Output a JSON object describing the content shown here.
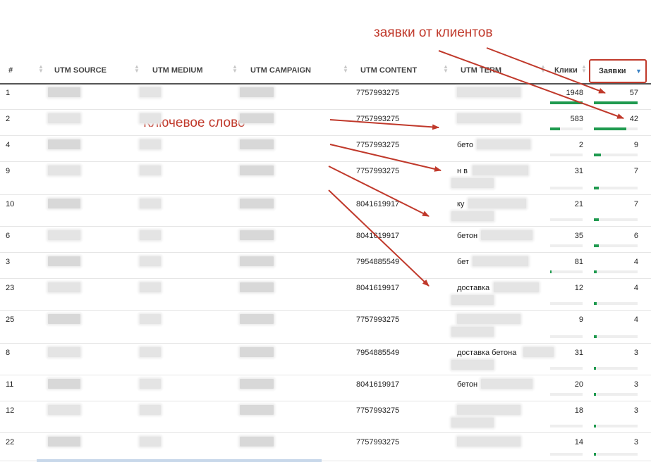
{
  "annotations": {
    "top": "заявки от клиентов",
    "keyword": "Ключевое слово"
  },
  "header": {
    "num": "#",
    "utm_source": "UTM SOURCE",
    "utm_medium": "UTM MEDIUM",
    "utm_campaign": "UTM CAMPAIGN",
    "utm_content": "UTM CONTENT",
    "utm_term": "UTM TERM",
    "clicks": "Клики",
    "leads": "Заявки"
  },
  "colors": {
    "accent_red": "#c0392b",
    "bar_green": "#1f9a4f",
    "sort_blue": "#3b82c4"
  },
  "rows": [
    {
      "num": "1",
      "content": "7757993275",
      "term": "",
      "clicks": "1948",
      "leads": "57",
      "clicks_frac": 1.0,
      "leads_frac": 1.0
    },
    {
      "num": "2",
      "content": "7757993275",
      "term": "",
      "clicks": "583",
      "leads": "42",
      "clicks_frac": 0.3,
      "leads_frac": 0.74
    },
    {
      "num": "4",
      "content": "7757993275",
      "term": "бето",
      "clicks": "2",
      "leads": "9",
      "clicks_frac": 0.0,
      "leads_frac": 0.16
    },
    {
      "num": "9",
      "content": "7757993275",
      "term": "н в",
      "clicks": "31",
      "leads": "7",
      "clicks_frac": 0.0,
      "leads_frac": 0.12
    },
    {
      "num": "10",
      "content": "8041619917",
      "term": "ку",
      "term2": "кра",
      "clicks": "21",
      "leads": "7",
      "clicks_frac": 0.0,
      "leads_frac": 0.12
    },
    {
      "num": "6",
      "content": "8041619917",
      "term": "бетон",
      "clicks": "35",
      "leads": "6",
      "clicks_frac": 0.0,
      "leads_frac": 0.11
    },
    {
      "num": "3",
      "content": "7954885549",
      "term": "бет",
      "clicks": "81",
      "leads": "4",
      "clicks_frac": 0.04,
      "leads_frac": 0.07
    },
    {
      "num": "23",
      "content": "8041619917",
      "term": "доставка",
      "clicks": "12",
      "leads": "4",
      "clicks_frac": 0.0,
      "leads_frac": 0.07
    },
    {
      "num": "25",
      "content": "7757993275",
      "term": "",
      "clicks": "9",
      "leads": "4",
      "clicks_frac": 0.0,
      "leads_frac": 0.07
    },
    {
      "num": "8",
      "content": "7954885549",
      "term": "доставка бетона",
      "clicks": "31",
      "leads": "3",
      "clicks_frac": 0.0,
      "leads_frac": 0.05
    },
    {
      "num": "11",
      "content": "8041619917",
      "term": "бетон",
      "clicks": "20",
      "leads": "3",
      "clicks_frac": 0.0,
      "leads_frac": 0.05
    },
    {
      "num": "12",
      "content": "7757993275",
      "term": "",
      "clicks": "18",
      "leads": "3",
      "clicks_frac": 0.0,
      "leads_frac": 0.05
    },
    {
      "num": "22",
      "content": "7757993275",
      "term": "",
      "clicks": "14",
      "leads": "3",
      "clicks_frac": 0.0,
      "leads_frac": 0.05
    }
  ]
}
